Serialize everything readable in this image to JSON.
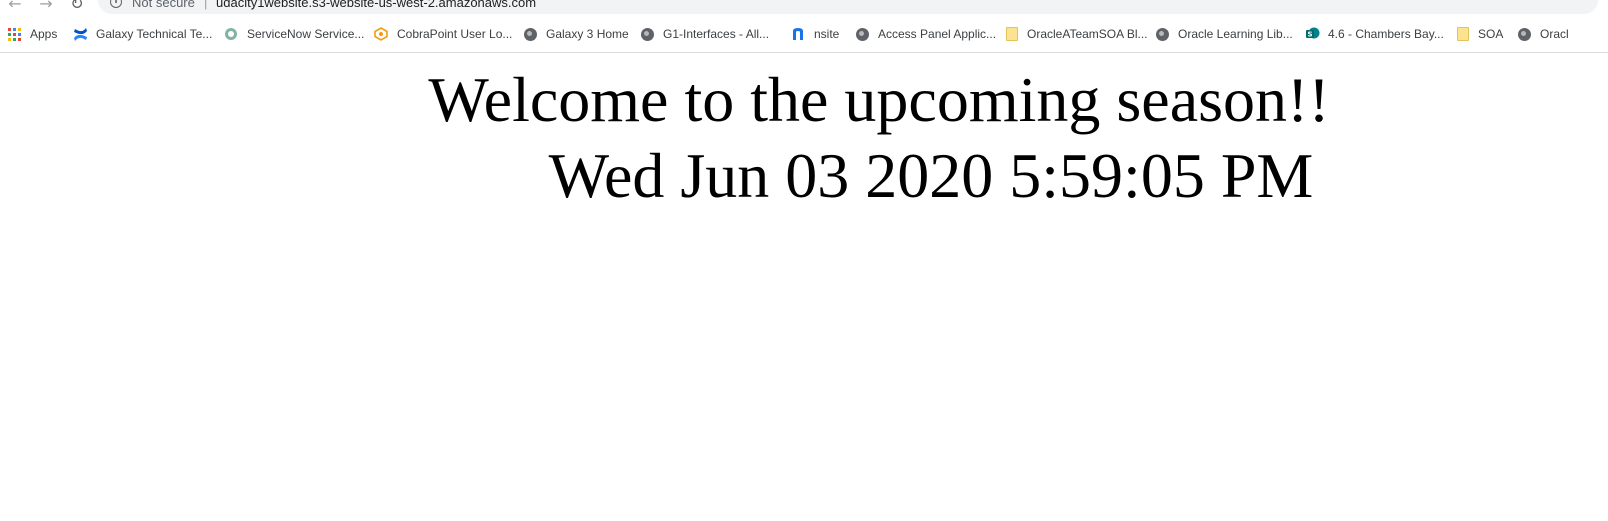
{
  "browser": {
    "security_label": "Not secure",
    "separator": "|",
    "url": "udacity1website.s3-website-us-west-2.amazonaws.com",
    "bookmarks": [
      {
        "label": "Apps",
        "icon": "apps-grid-icon"
      },
      {
        "label": "Galaxy Technical Te...",
        "icon": "confluence-icon"
      },
      {
        "label": "ServiceNow Service...",
        "icon": "servicenow-icon"
      },
      {
        "label": "CobraPoint User Lo...",
        "icon": "cobrapoint-icon"
      },
      {
        "label": "Galaxy 3 Home",
        "icon": "globe-icon"
      },
      {
        "label": "G1-Interfaces - All...",
        "icon": "globe-icon"
      },
      {
        "label": "nsite",
        "icon": "nsite-icon"
      },
      {
        "label": "Access Panel Applic...",
        "icon": "globe-icon"
      },
      {
        "label": "OracleATeamSOA Bl...",
        "icon": "folder-icon"
      },
      {
        "label": "Oracle Learning Lib...",
        "icon": "globe-icon"
      },
      {
        "label": "4.6 - Chambers Bay...",
        "icon": "sharepoint-icon"
      },
      {
        "label": "SOA",
        "icon": "folder-icon"
      },
      {
        "label": "Oracl",
        "icon": "globe-icon"
      }
    ]
  },
  "page": {
    "headline": "Welcome to the upcoming season!!",
    "datetime": "Wed Jun 03 2020 5:59:05 PM"
  },
  "colors": {
    "background": "#ffffff",
    "text": "#000000",
    "bookmark_text": "#3c4043",
    "omnibox": "#f1f3f4"
  }
}
